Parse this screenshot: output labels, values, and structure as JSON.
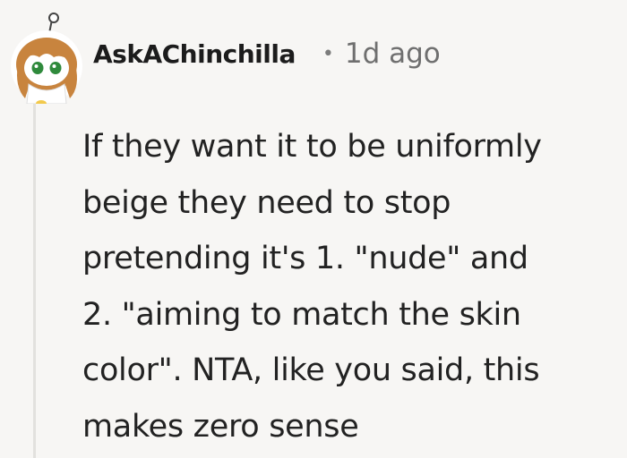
{
  "comment": {
    "author": "AskAChinchilla",
    "separator": "•",
    "timestamp": "1d ago",
    "avatar_icon": "snoo-avatar-icon",
    "body_lines": [
      "If they want it to be uniformly",
      "beige they need to stop",
      "pretending it's 1. \"nude\" and",
      "2. \"aiming to match the skin",
      "color\". NTA, like you said, this",
      "makes zero sense"
    ]
  },
  "colors": {
    "background": "#f7f6f4",
    "text": "#1c1c1c",
    "meta": "#6f6f6f",
    "thread_line": "#e2e1de"
  }
}
